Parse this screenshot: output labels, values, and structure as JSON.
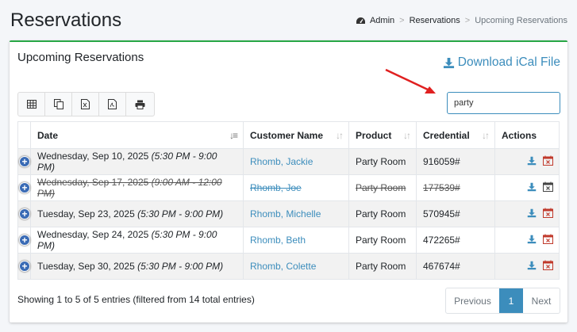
{
  "header": {
    "title": "Reservations",
    "breadcrumb": [
      "Admin",
      "Reservations",
      "Upcoming Reservations"
    ]
  },
  "card": {
    "title": "Upcoming Reservations",
    "ical_label": "Download iCal File"
  },
  "toolbar": {
    "buttons": [
      "table-icon",
      "copy-icon",
      "excel-icon",
      "pdf-icon",
      "print-icon"
    ]
  },
  "search": {
    "value": "party"
  },
  "table": {
    "headers": [
      "Date",
      "Customer Name",
      "Product",
      "Credential",
      "Actions"
    ],
    "rows": [
      {
        "date": "Wednesday, Sep 10, 2025",
        "time": "(5:30 PM - 9:00 PM)",
        "customer": "Rhomb, Jackie",
        "product": "Party Room",
        "credential": "916059#",
        "cancelled": false
      },
      {
        "date": "Wednesday, Sep 17, 2025",
        "time": "(9:00 AM - 12:00 PM)",
        "customer": "Rhomb, Joe",
        "product": "Party Room",
        "credential": "177539#",
        "cancelled": true
      },
      {
        "date": "Tuesday, Sep 23, 2025",
        "time": "(5:30 PM - 9:00 PM)",
        "customer": "Rhomb, Michelle",
        "product": "Party Room",
        "credential": "570945#",
        "cancelled": false
      },
      {
        "date": "Wednesday, Sep 24, 2025",
        "time": "(5:30 PM - 9:00 PM)",
        "customer": "Rhomb, Beth",
        "product": "Party Room",
        "credential": "472265#",
        "cancelled": false
      },
      {
        "date": "Tuesday, Sep 30, 2025",
        "time": "(5:30 PM - 9:00 PM)",
        "customer": "Rhomb, Colette",
        "product": "Party Room",
        "credential": "467674#",
        "cancelled": false
      }
    ]
  },
  "footer": {
    "info": "Showing 1 to 5 of 5 entries (filtered from 14 total entries)",
    "prev": "Previous",
    "page": "1",
    "next": "Next"
  },
  "colors": {
    "accent": "#3c8dbc",
    "card_border": "#28a745",
    "arrow": "#e02020",
    "cancel_icon": "#c0392b"
  }
}
